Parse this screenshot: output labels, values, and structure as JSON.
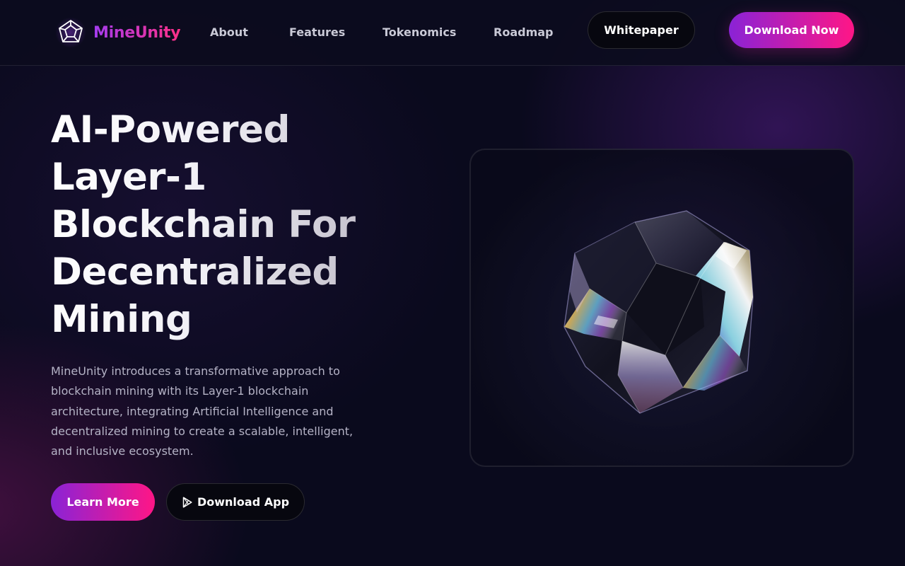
{
  "header": {
    "brand": "MineUnity",
    "nav": [
      {
        "label": "About"
      },
      {
        "label": "Features"
      },
      {
        "label": "Tokenomics"
      },
      {
        "label": "Roadmap"
      }
    ],
    "whitepaper_label": "Whitepaper",
    "download_now_label": "Download Now"
  },
  "hero": {
    "title_lines": [
      "AI-Powered",
      "Layer-1",
      "Blockchain For",
      "Decentralized",
      "Mining"
    ],
    "description": "MineUnity introduces a transformative approach to blockchain mining with its Layer-1 blockchain architecture, integrating Artificial Intelligence and decentralized mining to create a scalable, intelligent, and inclusive ecosystem.",
    "learn_more_label": "Learn More",
    "download_app_label": "Download App"
  },
  "icons": {
    "logo": "dodecahedron-logo-icon",
    "download_app": "play-store-icon",
    "showcase": "crystal-dodecahedron-image"
  },
  "colors": {
    "background": "#0a0a1d",
    "gradient_start": "#8a23d6",
    "gradient_end": "#ff1686",
    "nav_text": "#c9c9d6",
    "body_text": "#b5b3c6"
  }
}
